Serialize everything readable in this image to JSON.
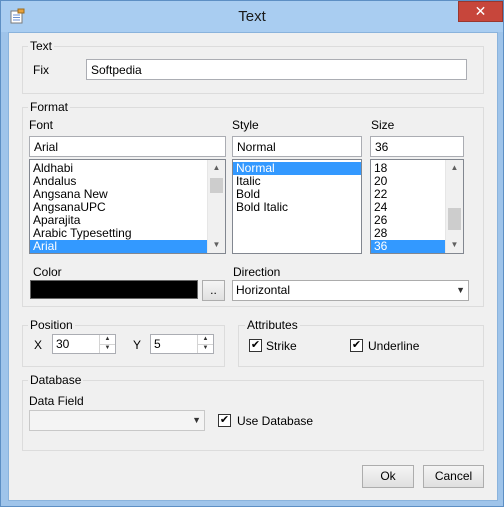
{
  "window": {
    "title": "Text",
    "close_label": "✕"
  },
  "text_group": {
    "label": "Text",
    "fix_label": "Fix",
    "fix_value": "Softpedia"
  },
  "format_group": {
    "label": "Format",
    "font": {
      "label": "Font",
      "value": "Arial",
      "items": [
        "Aldhabi",
        "Andalus",
        "Angsana New",
        "AngsanaUPC",
        "Aparajita",
        "Arabic Typesetting",
        "Arial"
      ],
      "selected": "Arial"
    },
    "style": {
      "label": "Style",
      "value": "Normal",
      "items": [
        "Normal",
        "Italic",
        "Bold",
        "Bold Italic"
      ],
      "selected": "Normal"
    },
    "size": {
      "label": "Size",
      "value": "36",
      "items": [
        "18",
        "20",
        "22",
        "24",
        "26",
        "28",
        "36"
      ],
      "selected": "36"
    },
    "color": {
      "label": "Color",
      "value": "#000000",
      "browse_label": ".."
    },
    "direction": {
      "label": "Direction",
      "value": "Horizontal"
    }
  },
  "position_group": {
    "label": "Position",
    "x_label": "X",
    "x_value": "30",
    "y_label": "Y",
    "y_value": "5"
  },
  "attributes_group": {
    "label": "Attributes",
    "strike_label": "Strike",
    "strike_checked": true,
    "underline_label": "Underline",
    "underline_checked": true
  },
  "database_group": {
    "label": "Database",
    "data_field_label": "Data Field",
    "data_field_value": "",
    "use_database_label": "Use Database",
    "use_database_checked": true
  },
  "buttons": {
    "ok": "Ok",
    "cancel": "Cancel"
  },
  "colors": {
    "accent": "#3399ff",
    "titlebar": "#a9cdf1",
    "close": "#c7463b"
  }
}
